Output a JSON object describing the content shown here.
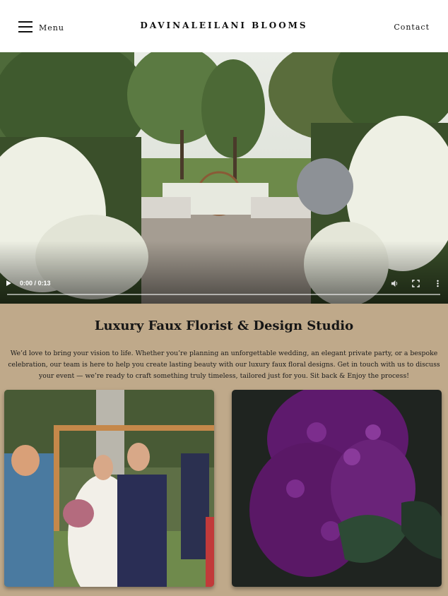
{
  "header": {
    "menu_label": "Menu",
    "brand": "DAVINALEILANI BLOOMS",
    "contact_label": "Contact"
  },
  "video": {
    "time": "0:00 / 0:13",
    "progress": 0,
    "icons": [
      "play-icon",
      "volume-icon",
      "fullscreen-icon",
      "more-options-icon"
    ]
  },
  "main": {
    "heading": "Luxury Faux Florist & Design Studio",
    "intro": "We’d love to bring your vision to life. Whether you’re planning an unforgettable wedding, an elegant private party, or a bespoke celebration, our team is here to help you create lasting beauty with our luxury faux floral designs. Get in touch with us to discuss your event — we’re ready to craft something truly timeless, tailored just for you. Sit back & Enjoy the process!"
  },
  "colors": {
    "page_background": "#bfa98a",
    "header_background": "#ffffff",
    "text": "#161616"
  }
}
